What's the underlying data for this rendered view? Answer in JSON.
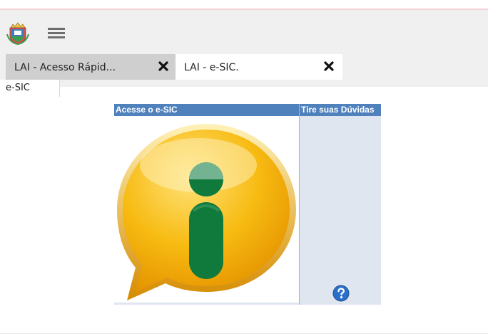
{
  "header": {
    "logo_icon": "municipal-coat-of-arms-icon",
    "menu_icon": "hamburger-menu-icon"
  },
  "tabs": [
    {
      "label": "LAI - Acesso Rápid...",
      "close_icon": "close-x-icon",
      "active": false
    },
    {
      "label": "LAI - e-SIC.",
      "close_icon": "close-x-icon",
      "active": true
    }
  ],
  "subtab": {
    "label": "e-SIC"
  },
  "panel": {
    "left_header": "Acesse o e-SIC",
    "right_header": "Tire suas Dúvidas",
    "left_icon": "information-speech-bubble-icon",
    "right_icon": "help-question-icon"
  },
  "colors": {
    "header_blue": "#4f81bd",
    "panel_light_blue": "#dfe6f0",
    "info_yellow": "#f5b400",
    "info_green": "#0f7a3c"
  }
}
